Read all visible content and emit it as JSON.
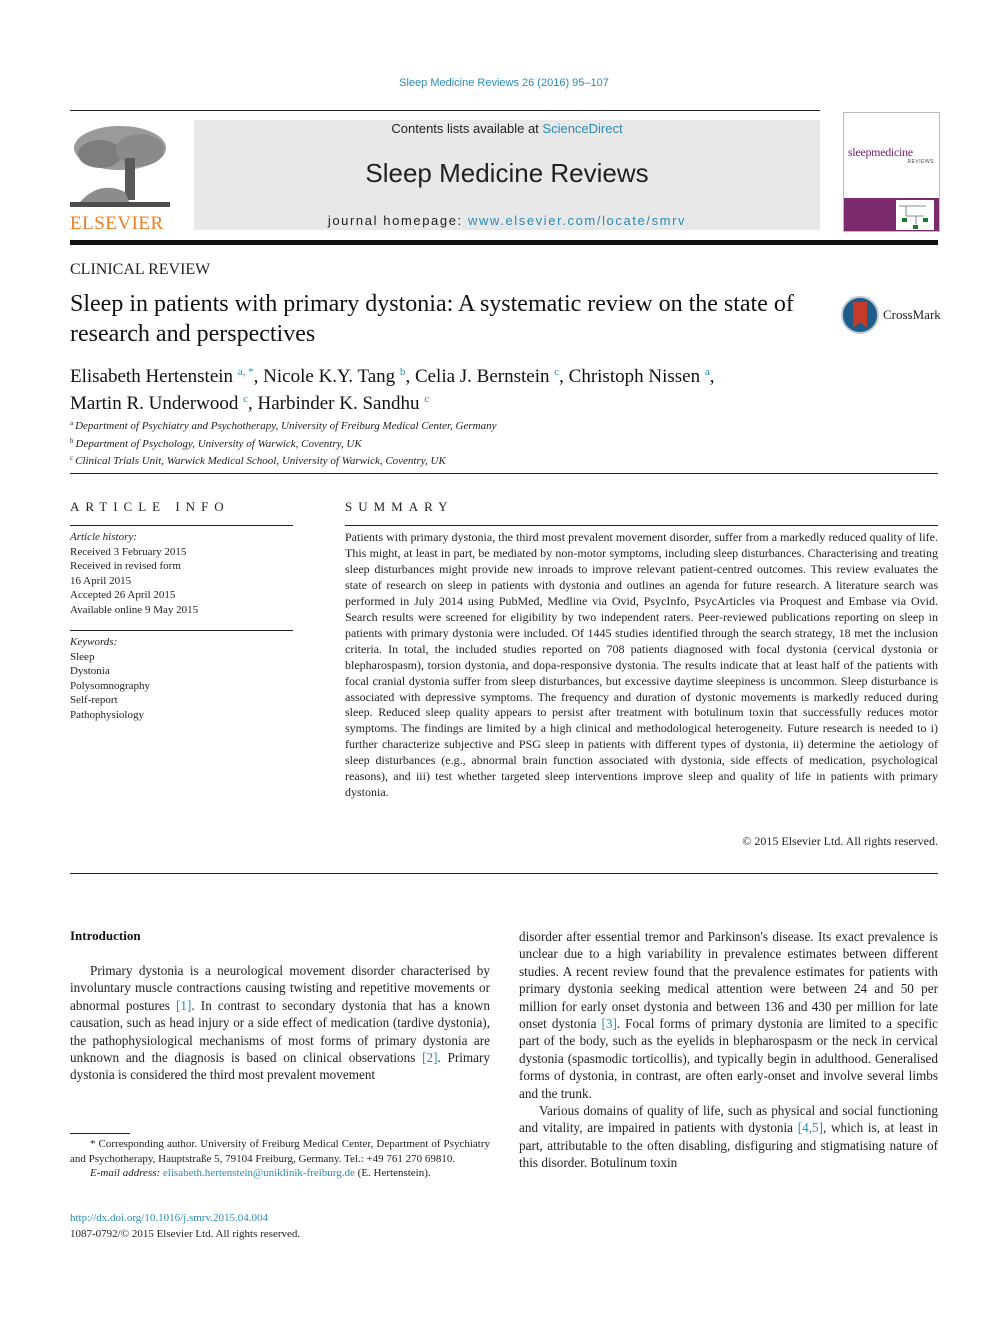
{
  "citation": "Sleep Medicine Reviews 26 (2016) 95–107",
  "header": {
    "publisher_logo_text": "ELSEVIER",
    "contents_prefix": "Contents lists available at ",
    "contents_link": "ScienceDirect",
    "journal_title": "Sleep Medicine Reviews",
    "homepage_prefix": "journal homepage: ",
    "homepage_link": "www.elsevier.com/locate/smrv",
    "cover_title": "sleepmedicine",
    "cover_subtitle": "REVIEWS",
    "colors": {
      "elsevier_orange": "#ee7d22",
      "link_blue": "#2a8ab5",
      "cover_purple": "#7b2a6e"
    }
  },
  "article": {
    "type": "CLINICAL REVIEW",
    "title": "Sleep in patients with primary dystonia: A systematic review on the state of research and perspectives",
    "crossmark_label": "CrossMark",
    "authors": [
      {
        "name": "Elisabeth Hertenstein",
        "sup": "a, *",
        "sep": ", "
      },
      {
        "name": "Nicole K.Y. Tang",
        "sup": "b",
        "sep": ", "
      },
      {
        "name": "Celia J. Bernstein",
        "sup": "c",
        "sep": ", "
      },
      {
        "name": "Christoph Nissen",
        "sup": "a",
        "sep": ","
      },
      {
        "name": "Martin R. Underwood",
        "sup": "c",
        "sep": ", "
      },
      {
        "name": "Harbinder K. Sandhu",
        "sup": "c",
        "sep": ""
      }
    ],
    "affiliations": [
      {
        "key": "a",
        "text": "Department of Psychiatry and Psychotherapy, University of Freiburg Medical Center, Germany"
      },
      {
        "key": "b",
        "text": "Department of Psychology, University of Warwick, Coventry, UK"
      },
      {
        "key": "c",
        "text": "Clinical Trials Unit, Warwick Medical School, University of Warwick, Coventry, UK"
      }
    ]
  },
  "article_info": {
    "heading": "ARTICLE INFO",
    "history_label": "Article history:",
    "history": [
      "Received 3 February 2015",
      "Received in revised form",
      "16 April 2015",
      "Accepted 26 April 2015",
      "Available online 9 May 2015"
    ],
    "keywords_label": "Keywords:",
    "keywords": [
      "Sleep",
      "Dystonia",
      "Polysomnography",
      "Self-report",
      "Pathophysiology"
    ]
  },
  "summary": {
    "heading": "SUMMARY",
    "text": "Patients with primary dystonia, the third most prevalent movement disorder, suffer from a markedly reduced quality of life. This might, at least in part, be mediated by non-motor symptoms, including sleep disturbances. Characterising and treating sleep disturbances might provide new inroads to improve relevant patient-centred outcomes. This review evaluates the state of research on sleep in patients with dystonia and outlines an agenda for future research. A literature search was performed in July 2014 using PubMed, Medline via Ovid, PsycInfo, PsycArticles via Proquest and Embase via Ovid. Search results were screened for eligibility by two independent raters. Peer-reviewed publications reporting on sleep in patients with primary dystonia were included. Of 1445 studies identified through the search strategy, 18 met the inclusion criteria. In total, the included studies reported on 708 patients diagnosed with focal dystonia (cervical dystonia or blepharospasm), torsion dystonia, and dopa-responsive dystonia. The results indicate that at least half of the patients with focal cranial dystonia suffer from sleep disturbances, but excessive daytime sleepiness is uncommon. Sleep disturbance is associated with depressive symptoms. The frequency and duration of dystonic movements is markedly reduced during sleep. Reduced sleep quality appears to persist after treatment with botulinum toxin that successfully reduces motor symptoms. The findings are limited by a high clinical and methodological heterogeneity. Future research is needed to i) further characterize subjective and PSG sleep in patients with different types of dystonia, ii) determine the aetiology of sleep disturbances (e.g., abnormal brain function associated with dystonia, side effects of medication, psychological reasons), and iii) test whether targeted sleep interventions improve sleep and quality of life in patients with primary dystonia.",
    "copyright": "© 2015 Elsevier Ltd. All rights reserved."
  },
  "body": {
    "intro_heading": "Introduction",
    "p1": {
      "s1": "Primary dystonia is a neurological movement disorder characterised by involuntary muscle contractions causing twisting and repetitive movements or abnormal postures ",
      "ref1": "[1]",
      "s2": ". In contrast to secondary dystonia that has a known causation, such as head injury or a side effect of medication (tardive dystonia), the pathophysiological mechanisms of most forms of primary dystonia are unknown and the diagnosis is based on clinical observations ",
      "ref2": "[2]",
      "s3": ". Primary dystonia is considered the third most prevalent movement",
      "s4": "disorder after essential tremor and Parkinson's disease. Its exact prevalence is unclear due to a high variability in prevalence estimates between different studies. A recent review found that the prevalence estimates for patients with primary dystonia seeking medical attention were between 24 and 50 per million for early onset dystonia and between 136 and 430 per million for late onset dystonia ",
      "ref3": "[3]",
      "s5": ". Focal forms of primary dystonia are limited to a specific part of the body, such as the eyelids in blepharospasm or the neck in cervical dystonia (spasmodic torticollis), and typically begin in adulthood. Generalised forms of dystonia, in contrast, are often early-onset and involve several limbs and the trunk."
    },
    "p2": {
      "s1": "Various domains of quality of life, such as physical and social functioning and vitality, are impaired in patients with dystonia ",
      "ref": "[4,5]",
      "s2": ", which is, at least in part, attributable to the often disabling, disfiguring and stigmatising nature of this disorder. Botulinum toxin"
    }
  },
  "footnotes": {
    "corresponding": "* Corresponding author. University of Freiburg Medical Center, Department of Psychiatry and Psychotherapy, Hauptstraße 5, 79104 Freiburg, Germany. Tel.: +49 761 270 69810.",
    "email_label": "E-mail address: ",
    "email": "elisabeth.hertenstein@uniklinik-freiburg.de",
    "email_suffix": " (E. Hertenstein).",
    "doi": "http://dx.doi.org/10.1016/j.smrv.2015.04.004",
    "issn_copyright": "1087-0792/© 2015 Elsevier Ltd. All rights reserved."
  }
}
